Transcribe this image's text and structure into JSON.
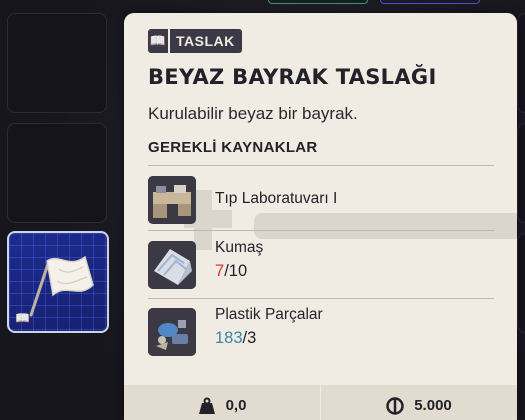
{
  "tooltip": {
    "badge": "TASLAK",
    "title": "BEYAZ BAYRAK TASLAĞI",
    "description": "Kurulabilir beyaz bir bayrak.",
    "section_title": "GEREKLİ KAYNAKLAR",
    "resources": [
      {
        "name": "Tıp Laboratuvarı I",
        "icon": "medical-lab-icon"
      },
      {
        "name": "Kumaş",
        "have": "7",
        "need": "/10",
        "status": "insufficient",
        "icon": "fabric-icon"
      },
      {
        "name": "Plastik Parçalar",
        "have": "183",
        "need": "/3",
        "status": "sufficient",
        "icon": "plastic-parts-icon"
      }
    ],
    "weight": "0,0",
    "value": "5.000"
  },
  "colors": {
    "panel": "#f1ece3",
    "badge_bg": "#3a3945",
    "insufficient": "#d7352d",
    "sufficient": "#3b86a7",
    "selected_slot": "#1f2b8f"
  }
}
